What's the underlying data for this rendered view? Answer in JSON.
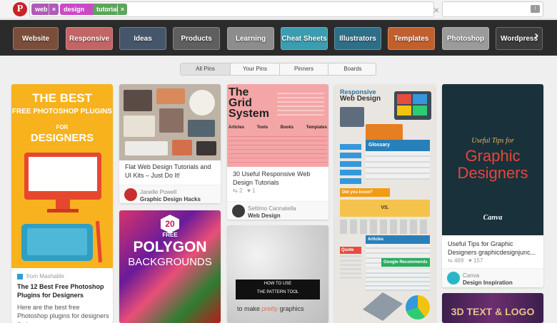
{
  "header": {
    "logo": "P",
    "search_tags": [
      {
        "label": "web",
        "color": "#b05ab8"
      },
      {
        "label": "design",
        "color": "#cc48c7"
      },
      {
        "label": "tutorial",
        "color": "#5aa65a"
      }
    ],
    "tag_remove": "×",
    "clear": "×",
    "menu": "≡",
    "notifications": "!"
  },
  "categories": [
    {
      "label": "Website",
      "color": "#7a4e3a"
    },
    {
      "label": "Responsive",
      "color": "#c46565"
    },
    {
      "label": "Ideas",
      "color": "#45566b"
    },
    {
      "label": "Products",
      "color": "#5f5f5f"
    },
    {
      "label": "Learning",
      "color": "#8d8d8d"
    },
    {
      "label": "Cheat Sheets",
      "color": "#3a9db0"
    },
    {
      "label": "Illustrators",
      "color": "#2e6f87"
    },
    {
      "label": "Templates",
      "color": "#c2602d"
    },
    {
      "label": "Photoshop",
      "color": "#9b9b9b"
    },
    {
      "label": "Wordpress",
      "color": "#3c3c3c"
    }
  ],
  "more_categories": "›",
  "tabs": [
    "All Pins",
    "Your Pins",
    "Pinners",
    "Boards"
  ],
  "pins": [
    {
      "image": {
        "heading": "THE BEST",
        "line2": "FREE PHOTOSHOP PLUGINS",
        "line3": "FOR",
        "line4": "DESIGNERS",
        "bg": "#f7b21e"
      },
      "source": "from Mashable",
      "title": "The 12 Best Free Photoshop Plugins for Designers",
      "description": "Here are the best free Photoshop plugins for designers that you can"
    },
    {
      "image": {
        "bg": "#bfb3a6"
      },
      "description": "Flat Web Design Tutorials and UI Kits – Just Do It!",
      "pinner": "Janelle Powell",
      "board": "Graphic Design Hacks",
      "image2": {
        "number": "20",
        "free": "FREE",
        "title1": "POLYGON",
        "title2": "BACKGROUNDS"
      }
    },
    {
      "image": {
        "title1": "The",
        "title2": "Grid",
        "title3": "System",
        "columns": [
          "Articles",
          "Tools",
          "Books",
          "Templates"
        ],
        "bg": "#f4a6a6"
      },
      "description": "30 Useful Responsive Web Design Tutorials",
      "repins": "2",
      "likes": "1",
      "pinner": "Settimo Cannatella",
      "board": "Web Design",
      "image2": {
        "line1": "HOW TO USE",
        "line2": "THE PATTERN TOOL",
        "line3": "to make",
        "line4": "pretty",
        "line5": "graphics"
      }
    },
    {
      "image": {
        "title1": "Responsive",
        "title2": "Web Design",
        "glossary": "Glossary",
        "didyou": "Did you know?",
        "vs": "VS.",
        "articles": "Articles",
        "recommends": "Google Recommends",
        "quote": "Quote"
      }
    },
    {
      "image": {
        "line1": "Useful Tips for",
        "line2": "Graphic",
        "line3": "Designers",
        "brand": "Canva",
        "bg": "#19313a"
      },
      "description": "Useful Tips for Graphic Designers graphicdesignjunc...",
      "repins": "469",
      "likes": "157",
      "pinner": "Canva",
      "board": "Design Inspiration",
      "image2": {
        "title": "3D TEXT & LOGO"
      }
    }
  ]
}
